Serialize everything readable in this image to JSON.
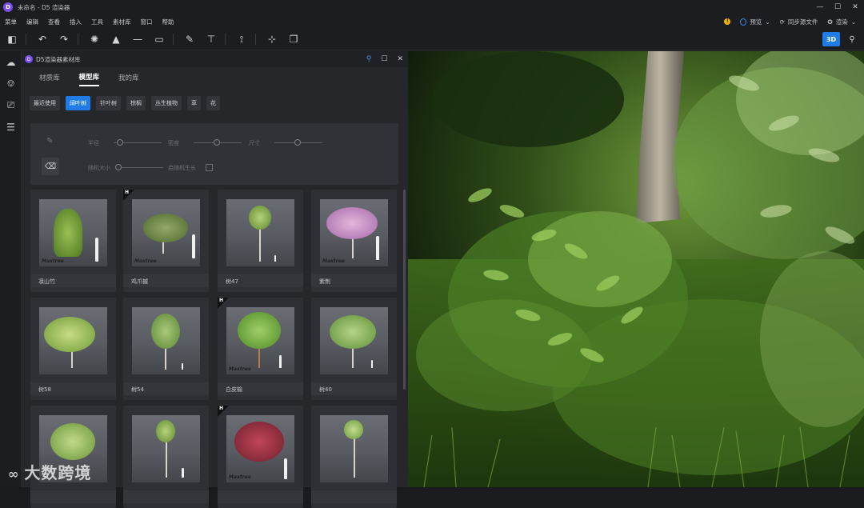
{
  "window": {
    "title": "未命名 - D5 渲染器",
    "app_logo": "D"
  },
  "menu": [
    "菜单",
    "编辑",
    "查看",
    "插入",
    "工具",
    "素材库",
    "窗口",
    "帮助"
  ],
  "menu_right": {
    "preview": "预览",
    "sync": "同步源文件",
    "render": "渲染"
  },
  "toolbar": {
    "view_3d": "3D"
  },
  "panel": {
    "title": "D5渲染器素材库",
    "tabs": [
      "材质库",
      "模型库",
      "我的库"
    ],
    "active_tab": "模型库",
    "chips": [
      "最近使用",
      "阔叶树",
      "针叶树",
      "棕榈",
      "丛生植物",
      "草",
      "花"
    ],
    "active_chip": "阔叶树",
    "brush": {
      "radius_label": "半径",
      "density_label": "密度",
      "size_label": "尺寸",
      "random_size_label": "随机大小",
      "random_growth_label": "启随机生长"
    }
  },
  "models": [
    {
      "label": "凛山竹",
      "badge": "",
      "brand": "Maxtree"
    },
    {
      "label": "鸡爪槭",
      "badge": "H",
      "brand": "Maxtree"
    },
    {
      "label": "树47",
      "badge": "",
      "brand": ""
    },
    {
      "label": "紫荆",
      "badge": "",
      "brand": "Maxtree"
    },
    {
      "label": "树58",
      "badge": "",
      "brand": ""
    },
    {
      "label": "树54",
      "badge": "",
      "brand": ""
    },
    {
      "label": "白皮榆",
      "badge": "H",
      "brand": "Maxtree"
    },
    {
      "label": "树40",
      "badge": "",
      "brand": ""
    },
    {
      "label": "",
      "badge": "",
      "brand": ""
    },
    {
      "label": "",
      "badge": "",
      "brand": ""
    },
    {
      "label": "",
      "badge": "H",
      "brand": "Maxtree"
    },
    {
      "label": "",
      "badge": "",
      "brand": ""
    }
  ],
  "watermark": "大数跨境",
  "colors": {
    "accent": "#1f7be6",
    "brand_purple": "#7a4df2",
    "warning": "#f0b400"
  }
}
